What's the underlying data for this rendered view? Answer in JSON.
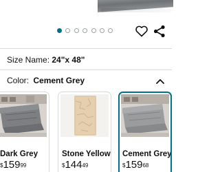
{
  "carousel": {
    "total_dots": 7,
    "active_index": 0
  },
  "actions": {
    "like_icon": "heart-icon",
    "share_icon": "share-icon"
  },
  "size": {
    "label": "Size Name:",
    "value": "24\"x 48\""
  },
  "color": {
    "label": "Color:",
    "value": "Cement Grey",
    "toggle_icon": "chevron-up-icon"
  },
  "swatches": [
    {
      "name": "Dark Grey",
      "currency": "$",
      "dollars": "159",
      "cents": "99",
      "selected": false
    },
    {
      "name": "Stone Yellow",
      "currency": "$",
      "dollars": "144",
      "cents": "49",
      "selected": false
    },
    {
      "name": "Cement Grey",
      "currency": "$",
      "dollars": "159",
      "cents": "68",
      "selected": true
    }
  ],
  "colors": {
    "accent": "#007185",
    "divider": "#d5d9d9",
    "text": "#0f1111"
  }
}
